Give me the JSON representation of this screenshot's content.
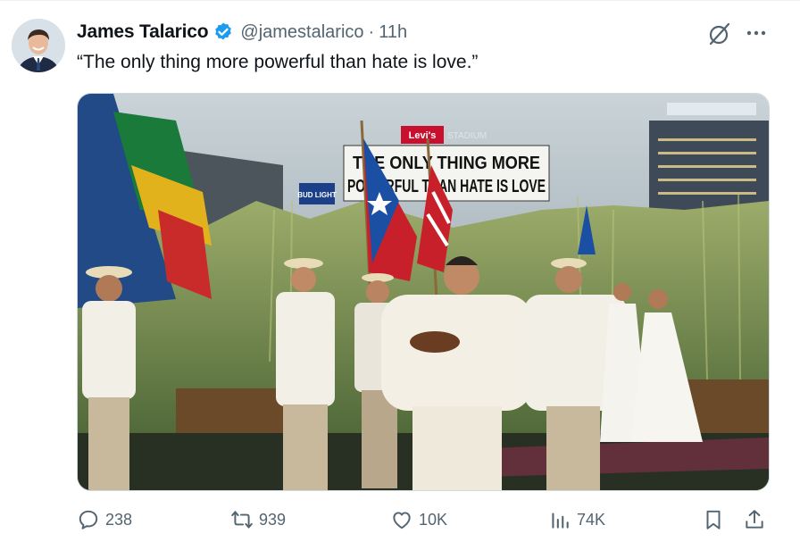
{
  "author": {
    "name": "James Talarico",
    "handle": "@jamestalarico",
    "separator": "·",
    "time": "11h",
    "verified": true
  },
  "tweet": {
    "text": "“The only thing more powerful than hate is love.”"
  },
  "media": {
    "sign_line1": "THE ONLY THING MORE",
    "sign_line2": "POWERFUL THAN HATE IS LOVE",
    "top_banner": "Levi's",
    "top_banner_suffix": "STADIUM",
    "side_banner": "BUD LIGHT"
  },
  "actions": {
    "replies": "238",
    "reposts": "939",
    "likes": "10K",
    "views": "74K"
  },
  "icons": {
    "reply": "reply-icon",
    "repost": "repost-icon",
    "like": "heart-icon",
    "views": "views-icon",
    "bookmark": "bookmark-icon",
    "share": "share-icon",
    "grok": "grok-icon",
    "more": "more-icon",
    "verified": "verified-badge-icon"
  },
  "colors": {
    "accent": "#1d9bf0",
    "secondary_text": "#536471"
  }
}
